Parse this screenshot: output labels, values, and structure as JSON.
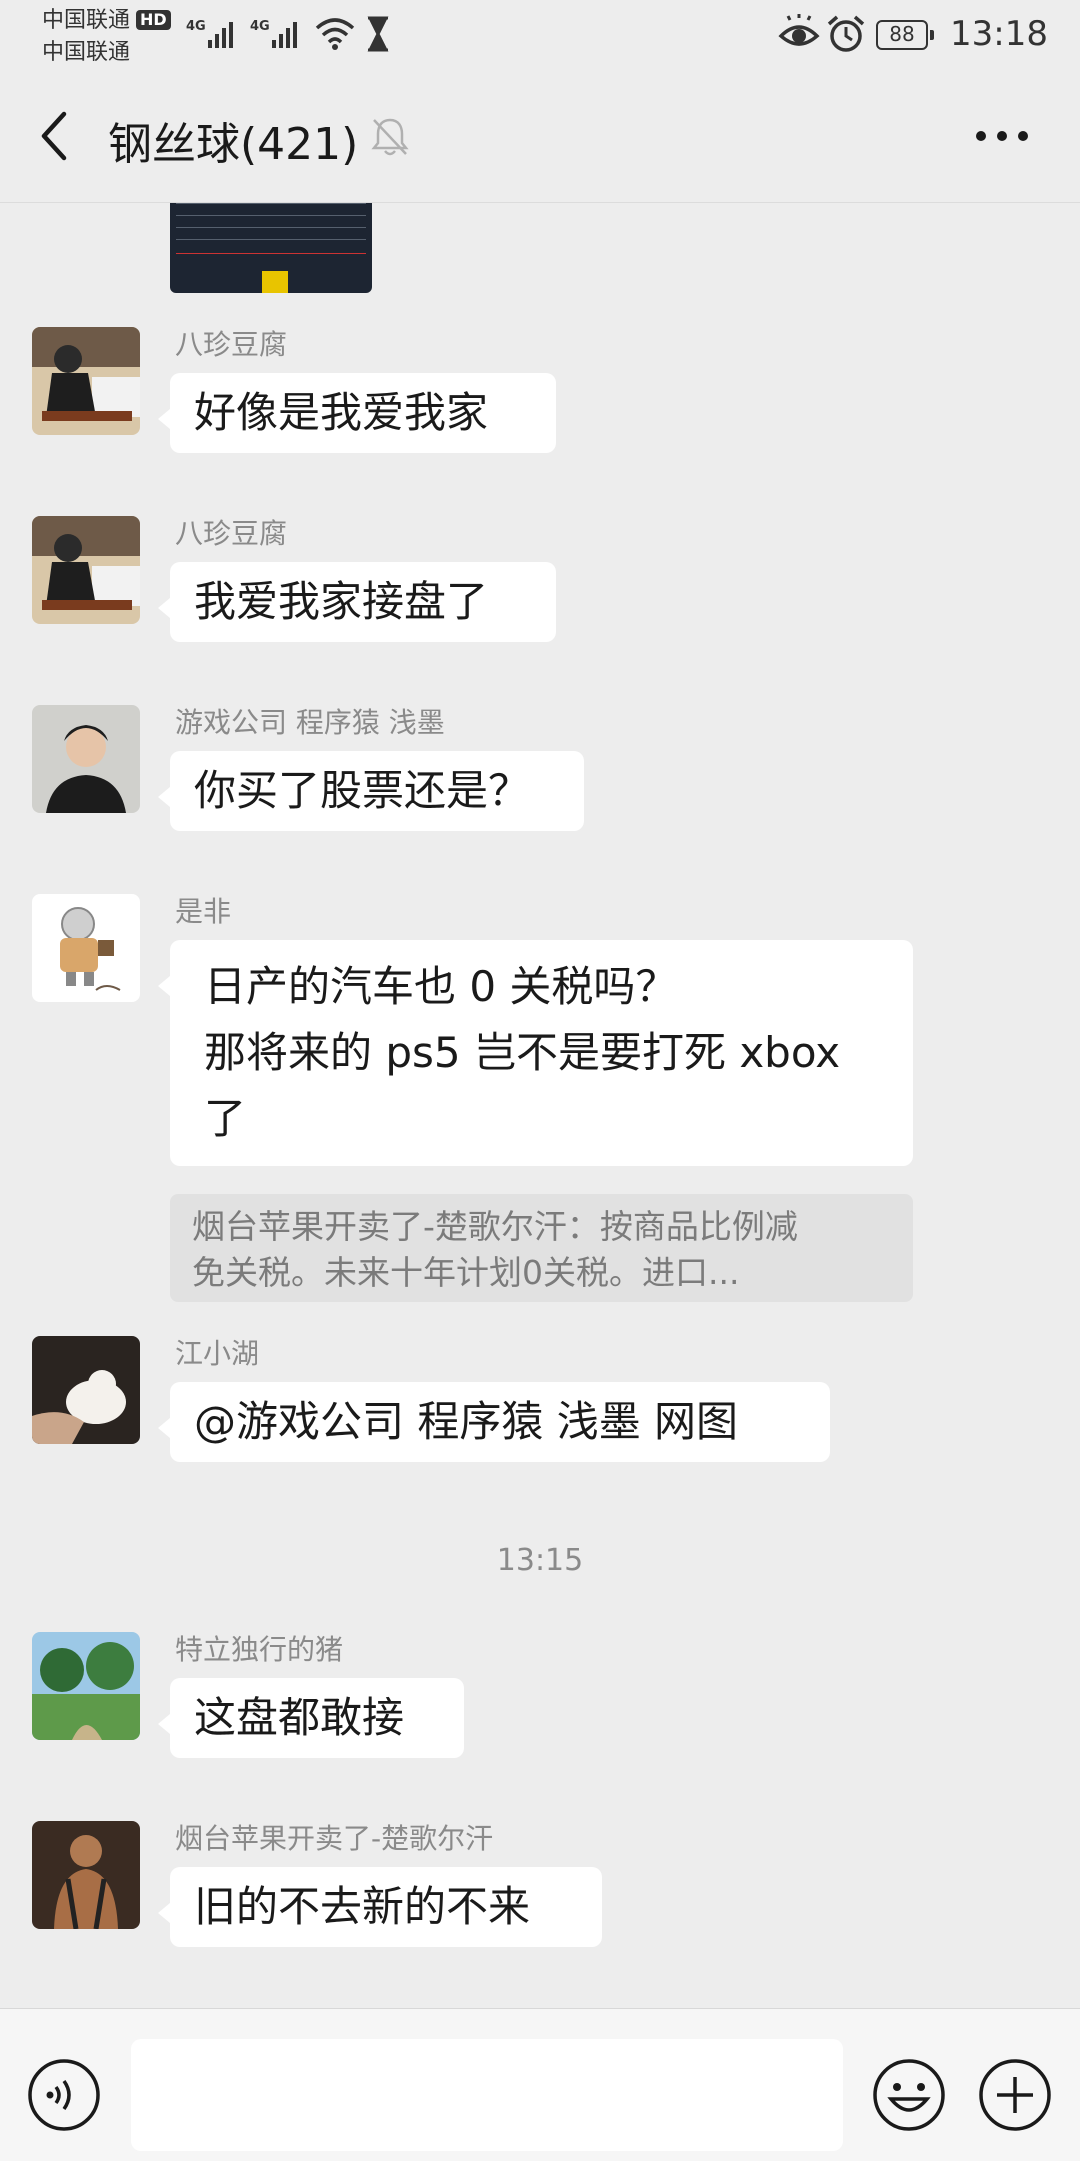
{
  "status_bar": {
    "carrier1": "中国联通",
    "hd_badge": "HD",
    "carrier2": "中国联通",
    "network1": "4G",
    "network2": "4G",
    "battery": "88",
    "time": "13:18"
  },
  "header": {
    "title": "钢丝球(421)",
    "icons": [
      "back-icon",
      "mute-bell-icon",
      "more-icon"
    ]
  },
  "messages": [
    {
      "sender": "八珍豆腐",
      "lines": [
        "好像是我爱我家"
      ]
    },
    {
      "sender": "八珍豆腐",
      "lines": [
        "我爱我家接盘了"
      ]
    },
    {
      "sender": "游戏公司 程序猿 浅墨",
      "lines": [
        "你买了股票还是？"
      ]
    },
    {
      "sender": "是非",
      "lines": [
        "日产的汽车也 0 关税吗？",
        "那将来的 ps5 岂不是要打死 xbox",
        "了"
      ],
      "quote": [
        "烟台苹果开卖了-楚歌尔汗：按商品比例减",
        "免关税。未来十年计划0关税。进口..."
      ]
    },
    {
      "sender": "江小湖",
      "lines": [
        "@游戏公司 程序猿 浅墨  网图"
      ]
    },
    {
      "sender": "特立独行的猪",
      "lines": [
        "这盘都敢接"
      ]
    },
    {
      "sender": "烟台苹果开卖了-楚歌尔汗",
      "lines": [
        "旧的不去新的不来"
      ]
    }
  ],
  "time_separator": "13:15",
  "input_bar": {
    "value": "",
    "icons": [
      "voice-icon",
      "emoji-icon",
      "plus-icon"
    ]
  }
}
